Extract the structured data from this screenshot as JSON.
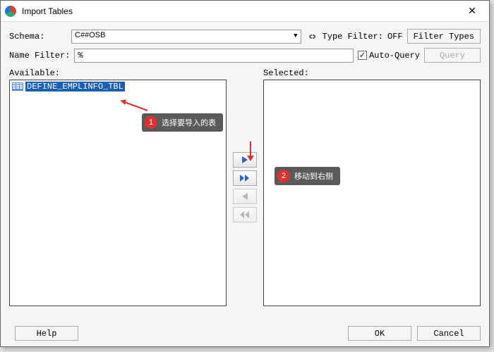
{
  "titlebar": {
    "title": "Import Tables"
  },
  "schema": {
    "label": "Schema:",
    "value": "C##OSB"
  },
  "type_filter": {
    "label": "Type Filter:",
    "value": "OFF",
    "button": "Filter Types"
  },
  "name_filter": {
    "label": "Name Filter:",
    "value": "%"
  },
  "auto_query": {
    "label": "Auto-Query",
    "checked": true
  },
  "query_button": "Query",
  "available": {
    "label": "Available:",
    "items": [
      {
        "text": "DEFINE_EMPLINFO_TBL",
        "selected": true
      }
    ]
  },
  "selected": {
    "label": "Selected:",
    "items": []
  },
  "footer": {
    "help": "Help",
    "ok": "OK",
    "cancel": "Cancel"
  },
  "annotations": {
    "a1": {
      "num": "1",
      "text": "选择要导入的表"
    },
    "a2": {
      "num": "2",
      "text": "移动到右侧"
    }
  }
}
